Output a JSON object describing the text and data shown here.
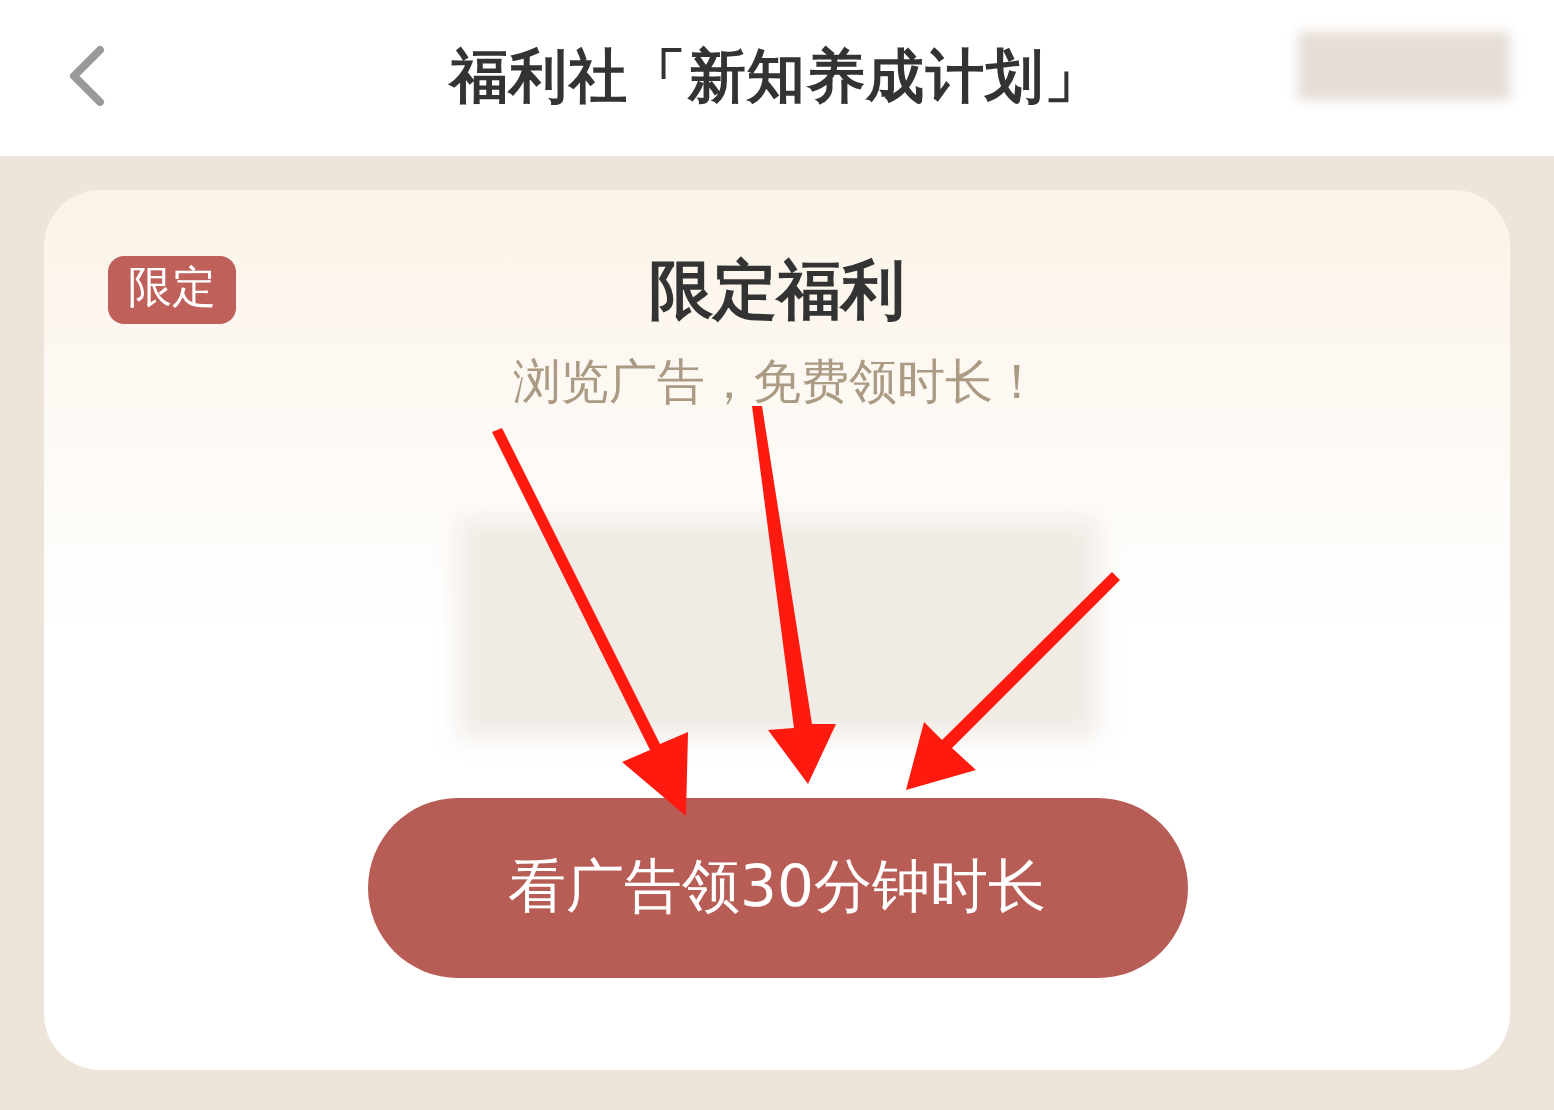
{
  "header": {
    "title": "福利社「新知养成计划」"
  },
  "card": {
    "badge": "限定",
    "title": "限定福利",
    "subtitle": "浏览广告，免费领时长！",
    "button": "看广告领30分钟时长"
  }
}
